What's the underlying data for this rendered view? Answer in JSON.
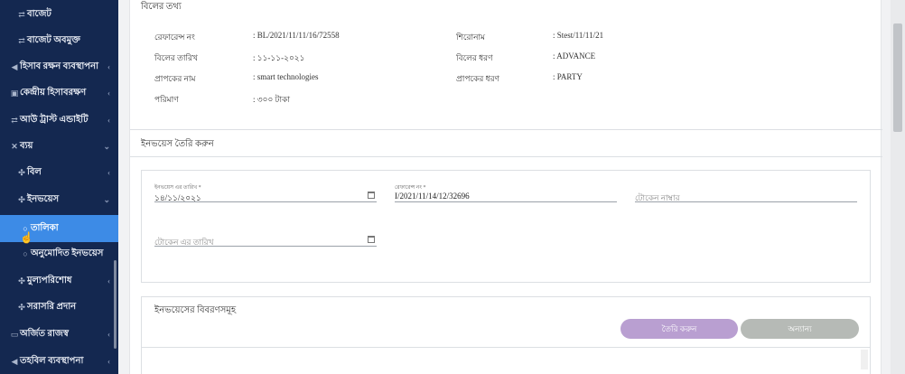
{
  "sidebar": {
    "items": [
      {
        "label": "বাজেট",
        "icon": "budget-icon"
      },
      {
        "label": "বাজেট অবমুক্ত",
        "icon": "budget-release-icon"
      },
      {
        "label": "হিসাব রক্ষন ব্যবস্থাপনা",
        "icon": "accounting-icon"
      },
      {
        "label": "কেন্দ্রীয় হিসাবরক্ষণ",
        "icon": "central-accounting-icon"
      },
      {
        "label": "আউ ট্রাস্ট এন্ডাইটি",
        "icon": "trust-icon"
      },
      {
        "label": "ব্যয়",
        "icon": "expense-icon"
      },
      {
        "label": "বিল",
        "icon": "bill-icon"
      },
      {
        "label": "ইনভয়েস",
        "icon": "invoice-icon"
      },
      {
        "label": "তালিকা",
        "icon": "list-icon"
      },
      {
        "label": "অনুমোদিত ইনভয়েস",
        "icon": "approved-invoice-icon"
      },
      {
        "label": "মুল্যপরিশোধ",
        "icon": "payment-icon"
      },
      {
        "label": "সরাসরি প্রদান",
        "icon": "direct-payment-icon"
      },
      {
        "label": "অর্জিত রাজস্ব",
        "icon": "revenue-icon"
      },
      {
        "label": "তহবিল ব্যবস্থাপনা",
        "icon": "fund-icon"
      }
    ]
  },
  "bill_info": {
    "title": "বিলের তথ্য",
    "reference_label": "রেফারেন্স নং",
    "reference_value": ": BL/2021/11/11/16/72558",
    "heading_label": "শিরোনাম",
    "heading_value": ": Stest/11/11/21",
    "date_label": "বিলের তারিখ",
    "date_value": ": ১১-১১-২০২১",
    "type_label": "বিলের ধরণ",
    "type_value": ": ADVANCE",
    "receiver_name_label": "প্রাপকের নাম",
    "receiver_name_value": ": smart technologies",
    "receiver_type_label": "প্রাপকের ধরণ",
    "receiver_type_value": ": PARTY",
    "amount_label": "পরিমাণ",
    "amount_value": ": ৩০০ টাকা"
  },
  "invoice_form": {
    "title": "ইনভয়েস তৈরি করুন",
    "invoice_date_label": "ইনভয়েস এর তারিখ *",
    "invoice_date_value": "১৪/১১/২০২১",
    "reference_label": "রেফারেন্স নং *",
    "reference_value": "I/2021/11/14/12/32696",
    "token_number_placeholder": "টোকেন নাম্বার",
    "token_date_placeholder": "টোকেন এর তারিখ"
  },
  "invoice_details": {
    "title": "ইনভয়েসের বিবরণসমূহ",
    "create_button": "তৈরি করুন",
    "other_button": "অন্যান্য"
  },
  "colors": {
    "sidebar_bg": "#142850",
    "active_item": "#3d8be6",
    "create_button": "#b99fd1",
    "other_button": "#b6bab6"
  }
}
